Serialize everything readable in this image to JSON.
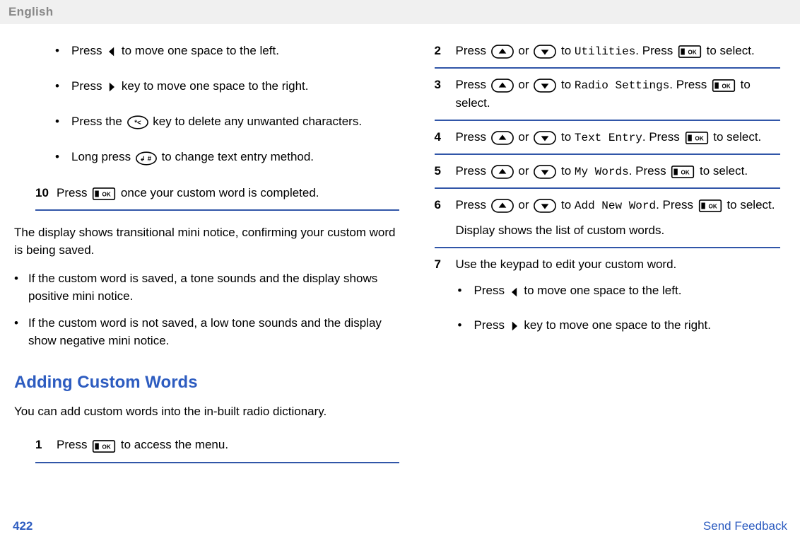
{
  "header": {
    "language": "English"
  },
  "left": {
    "bullets": [
      {
        "pre": "Press ",
        "icon": "caret-left",
        "post": " to move one space to the left."
      },
      {
        "pre": "Press ",
        "icon": "caret-right",
        "post": " key to move one space to the right."
      },
      {
        "pre": "Press the ",
        "icon": "star-key",
        "post": " key to delete any unwanted characters."
      },
      {
        "pre": "Long press ",
        "icon": "hash-key",
        "post": " to change text entry method."
      }
    ],
    "step10": {
      "num": "10",
      "pre": "Press ",
      "icon": "ok-key",
      "post": " once your custom word is completed."
    },
    "transition": "The display shows transitional mini notice, confirming your custom word is being saved.",
    "results": [
      "If the custom word is saved, a tone sounds and the display shows positive mini notice.",
      "If the custom word is not saved, a low tone sounds and the display show negative mini notice."
    ],
    "heading": "Adding Custom Words",
    "intro": "You can add custom words into the in-built radio dictionary.",
    "step1": {
      "num": "1",
      "pre": "Press ",
      "icon": "ok-key",
      "post": " to access the menu."
    }
  },
  "right": {
    "step2": {
      "num": "2",
      "pre": "Press ",
      "mid1": " or ",
      "mid2": " to ",
      "mono": "Utilities",
      "post1": ". Press ",
      "post2": " to select."
    },
    "step3": {
      "num": "3",
      "pre": "Press ",
      "mid1": " or ",
      "mid2": " to ",
      "mono": "Radio Settings",
      "post1": ". Press ",
      "post2": " to select."
    },
    "step4": {
      "num": "4",
      "pre": "Press ",
      "mid1": " or ",
      "mid2": " to ",
      "mono": "Text Entry",
      "post1": ". Press ",
      "post2": " to select."
    },
    "step5": {
      "num": "5",
      "pre": "Press ",
      "mid1": " or ",
      "mid2": " to ",
      "mono": "My Words",
      "post1": ". Press ",
      "post2": " to select."
    },
    "step6": {
      "num": "6",
      "pre": "Press ",
      "mid1": " or ",
      "mid2": " to ",
      "mono": "Add New Word",
      "post1": ". Press ",
      "post2": " to select.",
      "extra": "Display shows the list of custom words."
    },
    "step7": {
      "num": "7",
      "text": "Use the keypad to edit your custom word.",
      "bullets": [
        {
          "pre": "Press ",
          "icon": "caret-left",
          "post": " to move one space to the left."
        },
        {
          "pre": "Press ",
          "icon": "caret-right",
          "post": " key to move one space to the right."
        }
      ]
    }
  },
  "footer": {
    "page": "422",
    "feedback": "Send Feedback"
  }
}
